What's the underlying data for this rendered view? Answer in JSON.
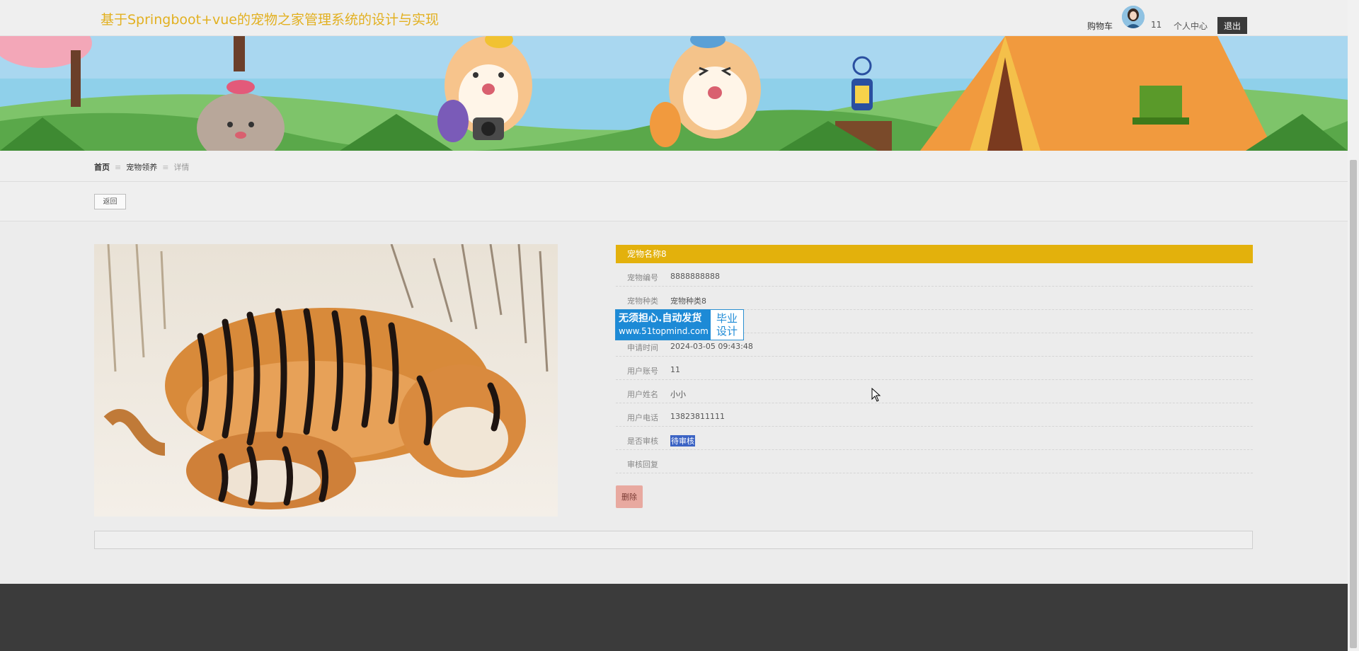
{
  "header": {
    "title": "基于Springboot+vue的宠物之家管理系统的设计与实现",
    "cart": "购物车",
    "username": "11",
    "center": "个人中心",
    "logout": "退出"
  },
  "breadcrumb": {
    "home": "首页",
    "section": "宠物领养",
    "current": "详情",
    "separator": "≡"
  },
  "back_label": "返回",
  "detail": {
    "title": "宠物名称8",
    "rows": [
      {
        "label": "宠物编号",
        "value": "8888888888"
      },
      {
        "label": "宠物种类",
        "value": "宠物种类8"
      },
      {
        "label": "",
        "value": ""
      },
      {
        "label": "申请时间",
        "value": "2024-03-05 09:43:48"
      },
      {
        "label": "用户账号",
        "value": "11"
      },
      {
        "label": "用户姓名",
        "value": "小小"
      },
      {
        "label": "用户电话",
        "value": "13823811111"
      },
      {
        "label": "是否审核",
        "value": "待审核"
      },
      {
        "label": "审核回复",
        "value": ""
      }
    ],
    "delete": "删除"
  },
  "watermark": {
    "line1": "无须担心.自动发货",
    "line2": "www.51topmind.com",
    "right1": "毕业",
    "right2": "设计"
  },
  "colors": {
    "accent": "#e3b10c",
    "title": "#e2b020",
    "footer": "#3b3b3b",
    "highlight": "#3b63c4"
  }
}
